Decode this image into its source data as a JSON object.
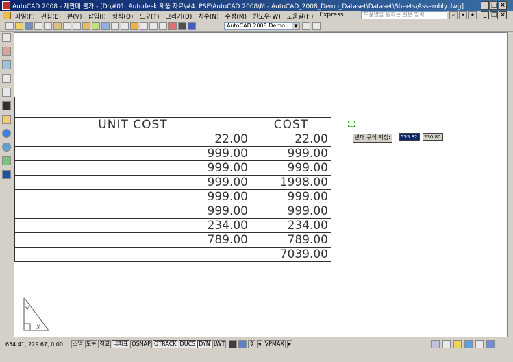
{
  "window": {
    "title": "AutoCAD 2008 - 재판매 불가 - [D:\\#01. Autodesk 제품 자료\\#4. PSE\\AutoCAD 2008\\M - AutoCAD_2008_Demo_Dataset\\Dataset\\Sheets\\Assembly.dwg]",
    "buttons": {
      "minimize": "_",
      "restore": "□",
      "close": "×"
    }
  },
  "menu": {
    "items": [
      "파일(F)",
      "편집(E)",
      "뷰(V)",
      "삽입(I)",
      "형식(O)",
      "도구(T)",
      "그리기(D)",
      "치수(N)",
      "수정(M)",
      "윈도우(W)",
      "도움말(H)",
      "Express"
    ],
    "help_placeholder": "도움말을 원하는 질문 입력"
  },
  "toolbar": {
    "workspace_value": "AutoCAD 2008 Demo"
  },
  "table": {
    "headers": [
      "UNIT COST",
      "COST"
    ],
    "rows": [
      [
        "22.00",
        "22.00"
      ],
      [
        "999.00",
        "999.00"
      ],
      [
        "999.00",
        "999.00"
      ],
      [
        "999.00",
        "1998.00"
      ],
      [
        "999.00",
        "999.00"
      ],
      [
        "999.00",
        "999.00"
      ],
      [
        "234.00",
        "234.00"
      ],
      [
        "789.00",
        "789.00"
      ]
    ],
    "total": "7039.00"
  },
  "dynamic_input": {
    "prompt": "반대 구석 지정:",
    "value1": "555.82",
    "value2": "230.80"
  },
  "status": {
    "coords": "654.41, 229.67, 0.00",
    "toggles": [
      {
        "label": "스냅",
        "on": false
      },
      {
        "label": "모눈",
        "on": false
      },
      {
        "label": "직교",
        "on": false
      },
      {
        "label": "극좌표",
        "on": true
      },
      {
        "label": "OSNAP",
        "on": false
      },
      {
        "label": "OTRACK",
        "on": true
      },
      {
        "label": "DUCS",
        "on": true
      },
      {
        "label": "DYN",
        "on": true
      },
      {
        "label": "LWT",
        "on": false
      }
    ],
    "vpmax": "VPMAX"
  }
}
